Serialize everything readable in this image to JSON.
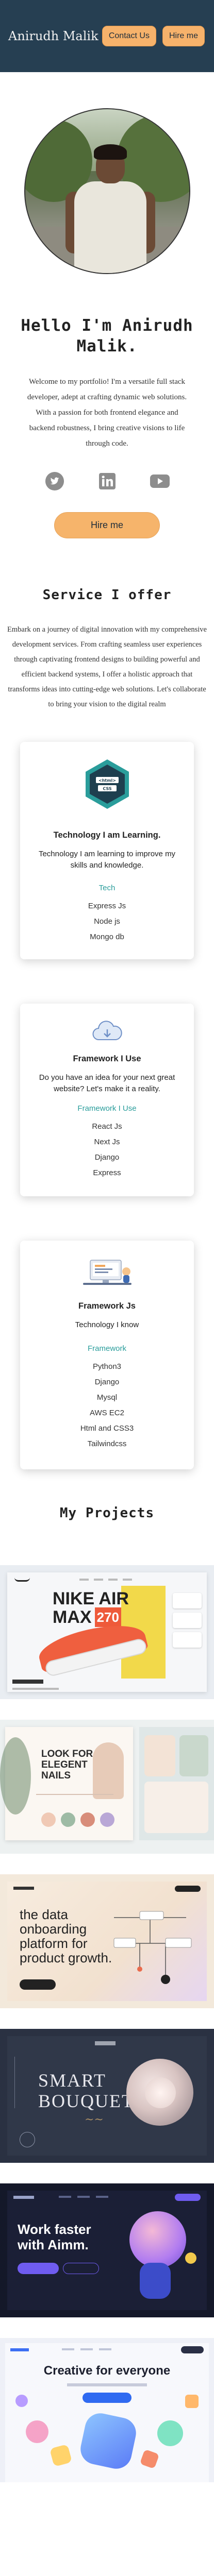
{
  "header": {
    "brand": "Anirudh Malik",
    "contact_label": "Contact Us",
    "hire_label": "Hire me"
  },
  "hero": {
    "title": "Hello I'm Anirudh Malik.",
    "bio": "Welcome to my portfolio! I'm a versatile full stack developer, adept at crafting dynamic web solutions. With a passion for both frontend elegance and backend robustness, I bring creative visions to life through code.",
    "hire_label": "Hire me",
    "social_icons": [
      "twitter-icon",
      "linkedin-icon",
      "youtube-icon"
    ]
  },
  "services": {
    "title": "Service I offer",
    "description": "Embark on a journey of digital innovation with my comprehensive development services. From crafting seamless user experiences through captivating frontend designs to building powerful and efficient backend systems, I offer a holistic approach that transforms ideas into cutting-edge web solutions. Let's collaborate to bring your vision to the digital realm",
    "cards": [
      {
        "icon": "html-css-badge-icon",
        "icon_text": [
          "<html>",
          "CSS"
        ],
        "title": "Technology I am Learning.",
        "subtitle": "Technology I am learning to improve my skills and knowledge.",
        "tag": "Tech",
        "items": [
          "Express Js",
          "Node js",
          "Mongo db"
        ]
      },
      {
        "icon": "cloud-icon",
        "title": "Framework I Use",
        "subtitle": "Do you have an idea for your next great website? Let's make it a reality.",
        "tag": "Framework I Use",
        "items": [
          "React Js",
          "Next Js",
          "Django",
          "Express"
        ]
      },
      {
        "icon": "developer-desk-icon",
        "title": "Framework Js",
        "subtitle": "Technology I know",
        "tag": "Framework",
        "items": [
          "Python3",
          "Django",
          "Mysql",
          "AWS EC2",
          "Html and CSS3",
          "Tailwindcss"
        ]
      }
    ]
  },
  "projects": {
    "title": "My Projects",
    "items": [
      {
        "name": "nike-air-project",
        "headline": [
          "NIKE AIR",
          "MAX"
        ],
        "badge": "270",
        "accent": "#f2d94a"
      },
      {
        "name": "nails-project",
        "headline": [
          "LOOK FOR",
          "ELEGENT",
          "NAILS"
        ],
        "accent": "#e7cbb8"
      },
      {
        "name": "data-onboarding-project",
        "headline": [
          "the data",
          "onboarding",
          "platform for",
          "product growth."
        ],
        "accent": "#f3e5d0"
      },
      {
        "name": "smart-bouquet-project",
        "headline": [
          "SMART",
          "BOUQUET"
        ],
        "accent": "#2c3345"
      },
      {
        "name": "aimm-project",
        "headline": [
          "Work faster",
          "with Aimm."
        ],
        "accent": "#1a1e33"
      },
      {
        "name": "creative-project",
        "headline": [
          "Creative for everyone"
        ],
        "accent": "#f5f6fb"
      }
    ]
  },
  "colors": {
    "header_bg": "#263f52",
    "accent_orange": "#f6b46b",
    "tag_teal": "#2a9d9b"
  }
}
